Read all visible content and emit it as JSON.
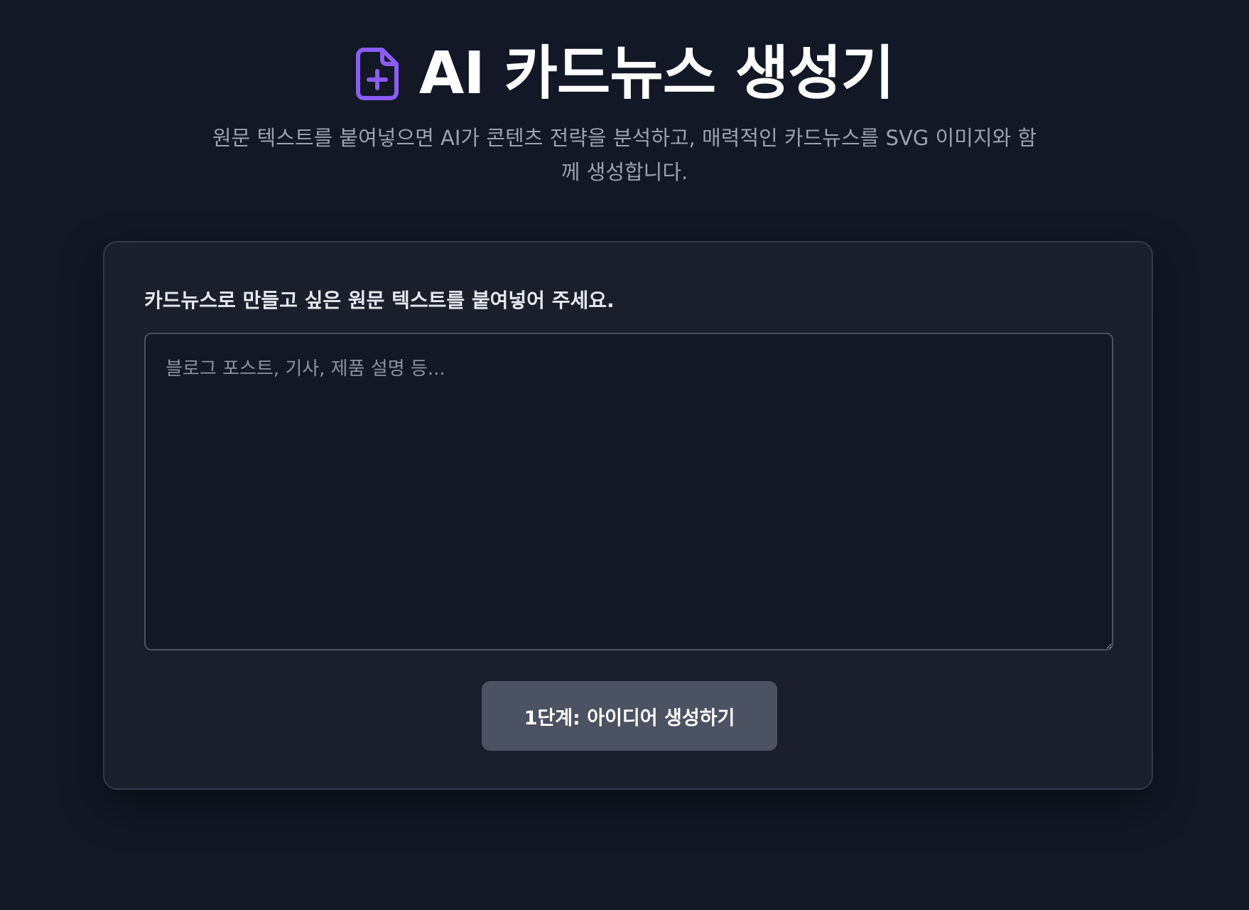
{
  "header": {
    "title": "AI 카드뉴스 생성기",
    "icon": "file-plus-icon",
    "icon_color": "#8b5cf6",
    "subtitle": "원문 텍스트를 붙여넣으면 AI가 콘텐츠 전략을 분석하고, 매력적인 카드뉴스를 SVG 이미지와 함께 생성합니다."
  },
  "form": {
    "label": "카드뉴스로 만들고 싶은 원문 텍스트를 붙여넣어 주세요.",
    "textarea_placeholder": "블로그 포스트, 기사, 제품 설명 등...",
    "textarea_value": "",
    "submit_label": "1단계: 아이디어 생성하기"
  },
  "colors": {
    "background": "#121826",
    "card": "#1b1f2c",
    "button": "#4b5261",
    "accent": "#8b5cf6"
  }
}
